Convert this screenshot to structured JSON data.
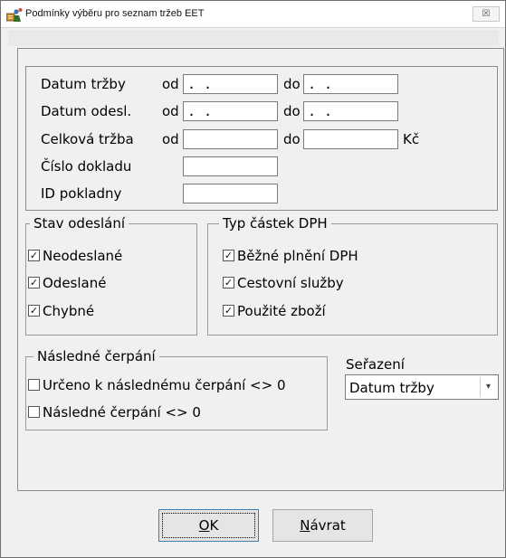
{
  "window": {
    "title": "Podmínky výběru pro seznam tržeb EET",
    "close_glyph": "☒"
  },
  "criteria": {
    "rows": [
      {
        "label": "Datum tržby",
        "from_label": "od",
        "from_value": ". .",
        "to_label": "do",
        "to_value": ". ."
      },
      {
        "label": "Datum odesl.",
        "from_label": "od",
        "from_value": ". .",
        "to_label": "do",
        "to_value": ". ."
      },
      {
        "label": "Celková tržba",
        "from_label": "od",
        "from_value": "",
        "to_label": "do",
        "to_value": "",
        "unit": "Kč"
      },
      {
        "label": "Číslo dokladu",
        "value": ""
      },
      {
        "label": "ID pokladny",
        "value": ""
      }
    ]
  },
  "stav_odeslani": {
    "title": "Stav odeslání",
    "items": [
      {
        "label": "Neodeslané",
        "checked": true
      },
      {
        "label": "Odeslané",
        "checked": true
      },
      {
        "label": "Chybné",
        "checked": true
      }
    ]
  },
  "typ_castek": {
    "title": "Typ částek DPH",
    "items": [
      {
        "label": "Běžné plnění DPH",
        "checked": true
      },
      {
        "label": "Cestovní služby",
        "checked": true
      },
      {
        "label": "Použité zboží",
        "checked": true
      }
    ]
  },
  "nasledne_cerpani": {
    "title": "Následné čerpání",
    "items": [
      {
        "label": "Určeno k následnému čerpání <> 0",
        "checked": false
      },
      {
        "label": "Následné čerpání <> 0",
        "checked": false
      }
    ]
  },
  "sort": {
    "label": "Seřazení",
    "selected": "Datum tržby"
  },
  "buttons": {
    "ok_label": "OK",
    "return_label": "Návrat"
  },
  "icons": {
    "app": "ledger-app-icon",
    "close": "close-icon",
    "dropdown": "chevron-down-icon",
    "checkbox": "checkbox-icon"
  }
}
